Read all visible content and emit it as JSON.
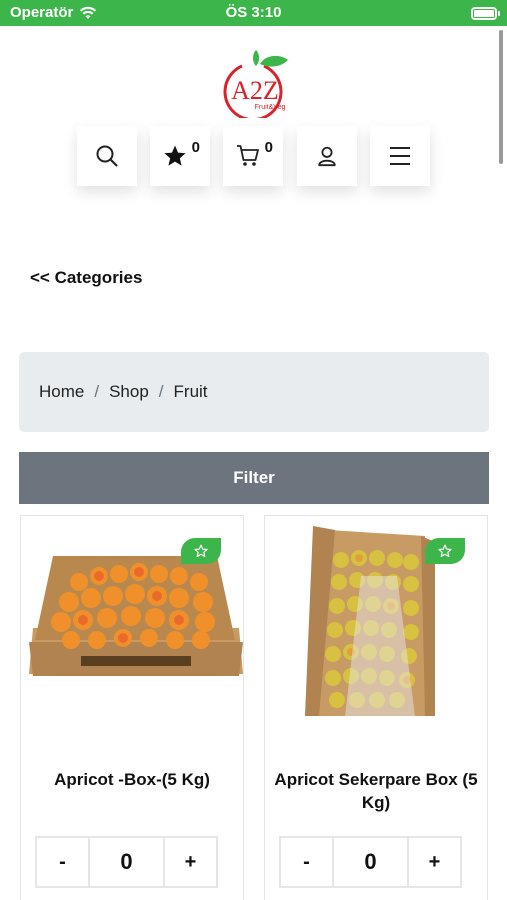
{
  "status_bar": {
    "carrier": "Operatör",
    "time": "ÖS 3:10"
  },
  "brand": {
    "logo_text": "A2Z",
    "logo_subtext": "Fruit&Veg",
    "accent_color": "#3cb64a",
    "logo_red": "#d8232a"
  },
  "nav": {
    "icons": [
      "search-icon",
      "star-icon",
      "cart-icon",
      "user-icon",
      "menu-icon"
    ],
    "favorites_count": "0",
    "cart_count": "0"
  },
  "categories_link": "<< Categories",
  "breadcrumb": {
    "items": [
      "Home",
      "Shop",
      "Fruit"
    ],
    "separator": "/"
  },
  "filter_label": "Filter",
  "products": [
    {
      "name": "Apricot -Box-(5 Kg)",
      "quantity": "0",
      "minus": "-",
      "plus": "+"
    },
    {
      "name": "Apricot Sekerpare Box (5 Kg)",
      "quantity": "0",
      "minus": "-",
      "plus": "+"
    }
  ]
}
